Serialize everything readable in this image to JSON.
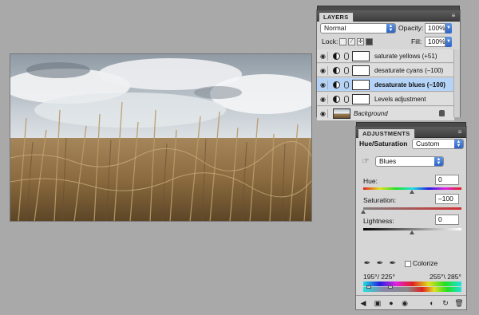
{
  "layers_panel": {
    "tab": "LAYERS",
    "menu_icon": "panel-menu-icon",
    "blend_mode": "Normal",
    "opacity_label": "Opacity:",
    "opacity_value": "100%",
    "lock_label": "Lock:",
    "fill_label": "Fill:",
    "fill_value": "100%",
    "layers": [
      {
        "name": "saturate yellows (+51)",
        "selected": false
      },
      {
        "name": "desaturate cyans (–100)",
        "selected": false
      },
      {
        "name": "desaturate blues (–100)",
        "selected": true
      },
      {
        "name": "Levels adjustment",
        "selected": false
      }
    ],
    "background_layer": "Background"
  },
  "adjustments_panel": {
    "tab": "ADJUSTMENTS",
    "title": "Hue/Saturation",
    "preset": "Custom",
    "channel": "Blues",
    "hue_label": "Hue:",
    "hue_value": "0",
    "saturation_label": "Saturation:",
    "saturation_value": "–100",
    "lightness_label": "Lightness:",
    "lightness_value": "0",
    "colorize_label": "Colorize",
    "range_left": "195°/ 225°",
    "range_right": "255°\\ 285°",
    "colors": {
      "selection": "#b5d3f7",
      "select_accent": "#2e63c4"
    }
  }
}
